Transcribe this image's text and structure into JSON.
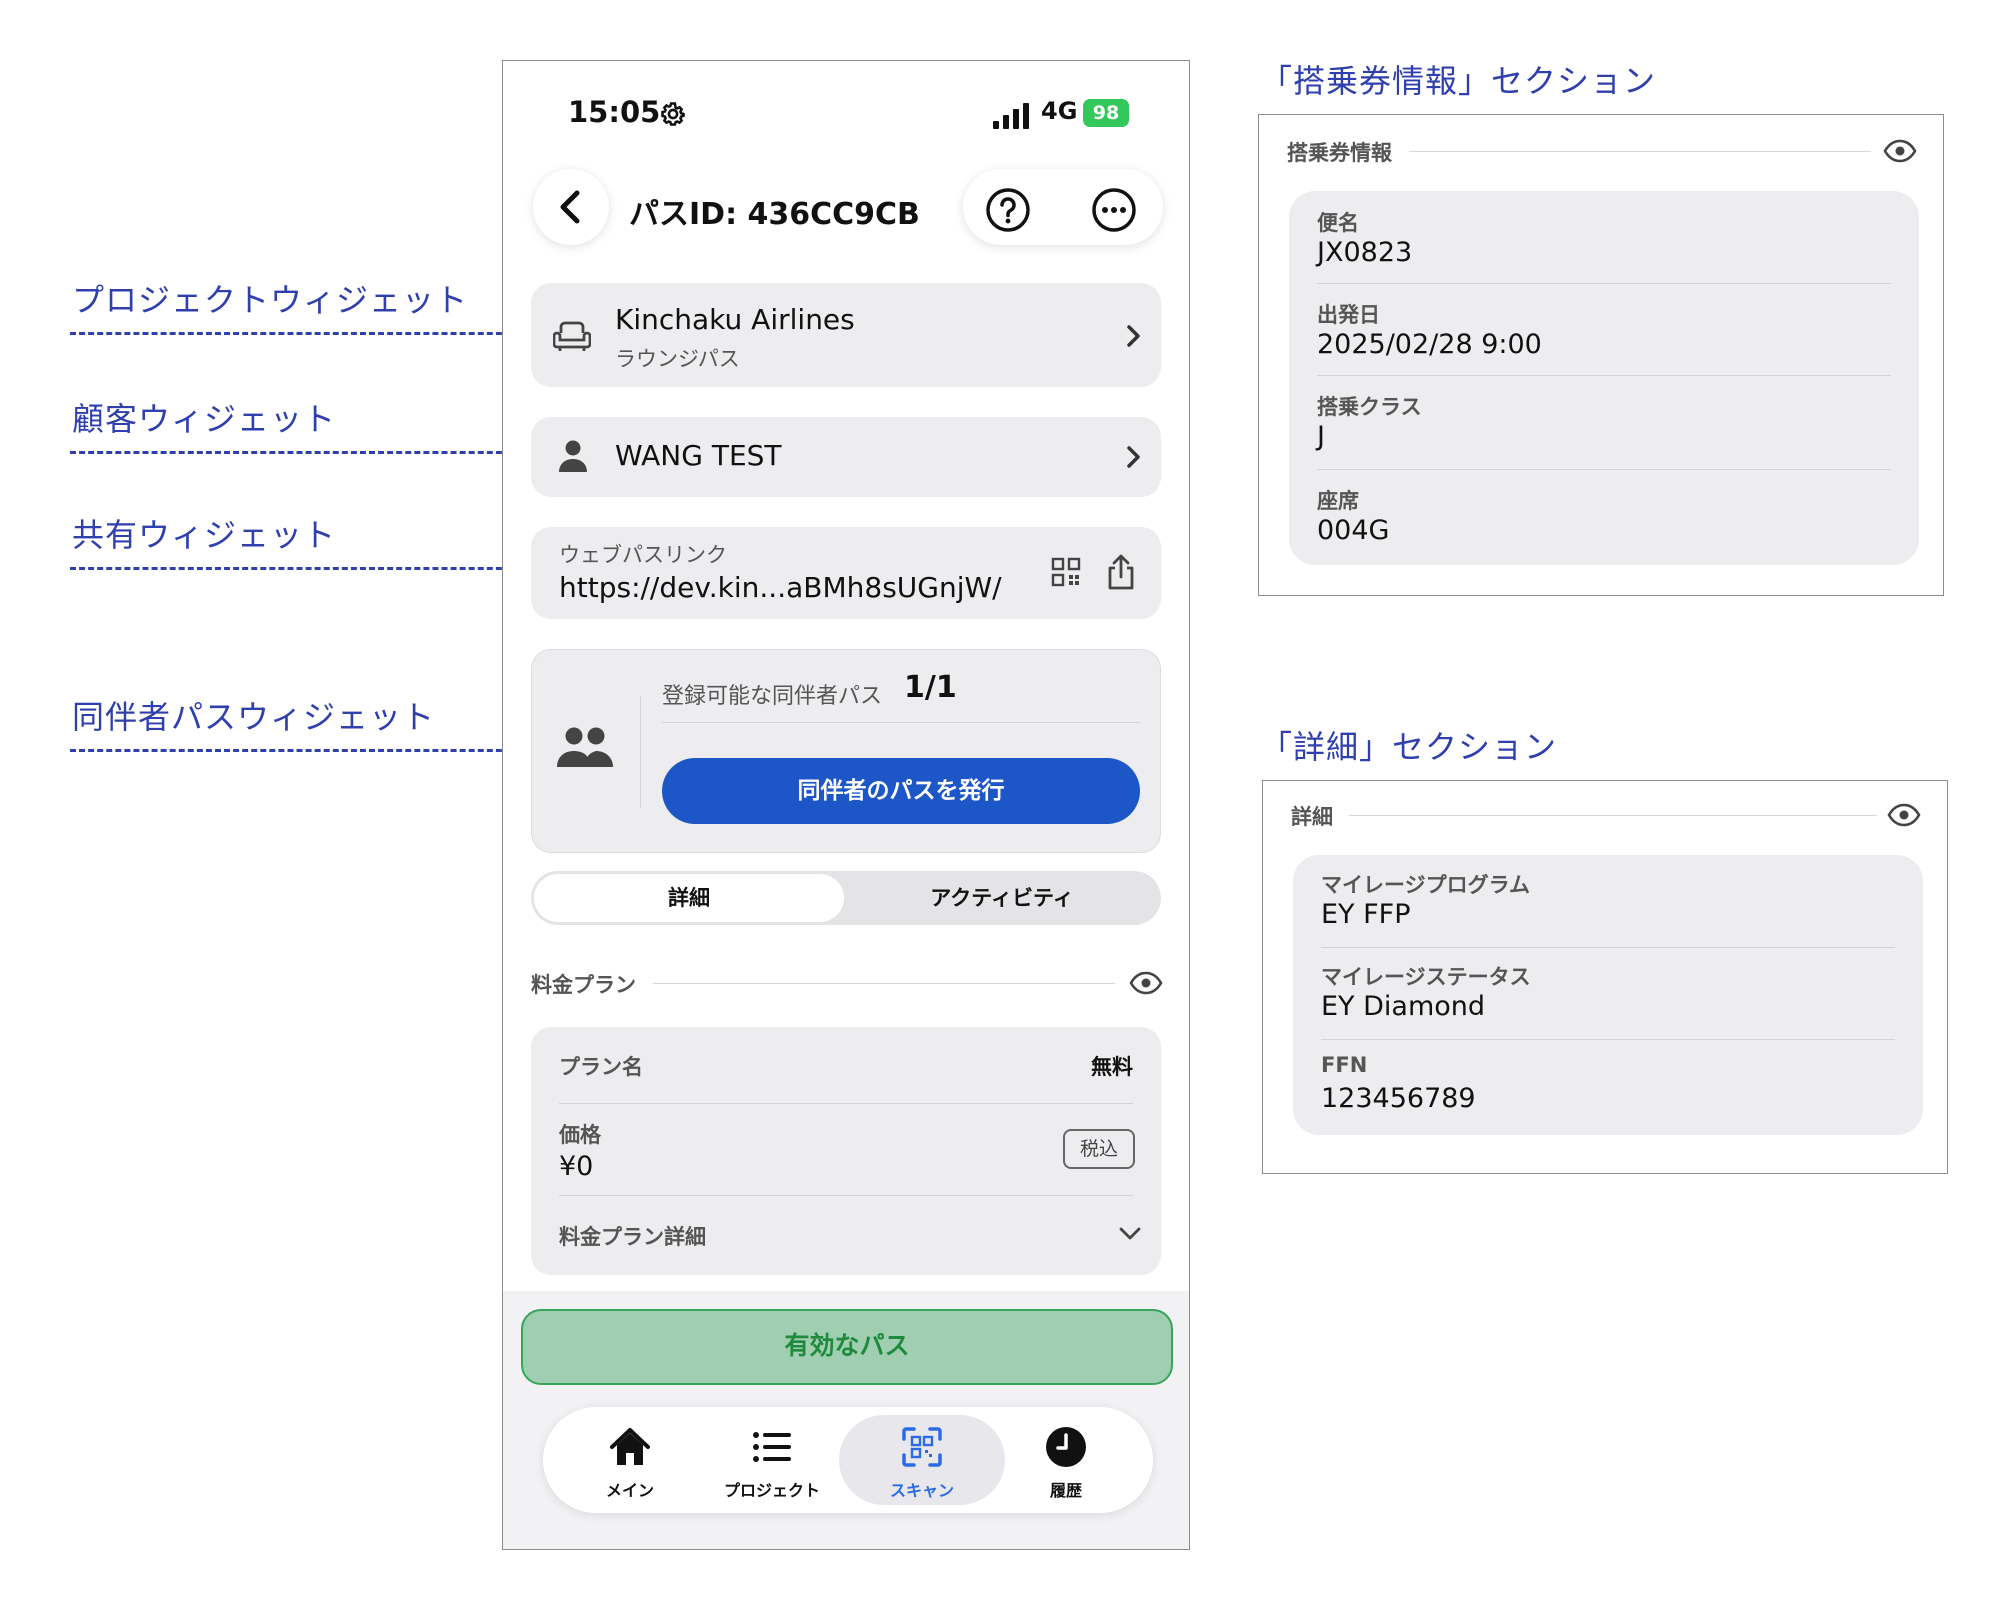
{
  "annotations": {
    "project_widget": "プロジェクトウィジェット",
    "customer_widget": "顧客ウィジェット",
    "share_widget": "共有ウィジェット",
    "companion_widget": "同伴者パスウィジェット"
  },
  "status_bar": {
    "time": "15:05",
    "network": "4G",
    "battery": "98"
  },
  "nav": {
    "title": "パスID: 436CC9CB"
  },
  "project": {
    "name": "Kinchaku Airlines",
    "type": "ラウンジパス"
  },
  "customer": {
    "name": "WANG TEST"
  },
  "share": {
    "label": "ウェブパスリンク",
    "url": "https://dev.kin...aBMh8sUGnjW/"
  },
  "companion": {
    "label": "登録可能な同伴者パス",
    "count": "1/1",
    "button": "同伴者のパスを発行"
  },
  "tabs": {
    "details": "詳細",
    "activity": "アクティビティ"
  },
  "plan": {
    "section_title": "料金プラン",
    "name_label": "プラン名",
    "name_value": "無料",
    "price_label": "価格",
    "price_value": "¥0",
    "tax_tag": "税込",
    "details_label": "料金プラン詳細"
  },
  "valid_button": "有効なパス",
  "tabbar": {
    "main": "メイン",
    "projects": "プロジェクト",
    "scan": "スキャン",
    "history": "履歴"
  },
  "boarding_panel": {
    "heading": "「搭乗券情報」セクション",
    "section_title": "搭乗券情報",
    "rows": [
      {
        "label": "便名",
        "value": "JX0823"
      },
      {
        "label": "出発日",
        "value": "2025/02/28 9:00"
      },
      {
        "label": "搭乗クラス",
        "value": "J"
      },
      {
        "label": "座席",
        "value": "004G"
      }
    ]
  },
  "details_panel": {
    "heading": "「詳細」セクション",
    "section_title": "詳細",
    "rows": [
      {
        "label": "マイレージプログラム",
        "value": "EY FFP"
      },
      {
        "label": "マイレージステータス",
        "value": "EY Diamond"
      },
      {
        "label": "FFN",
        "value": "123456789"
      }
    ]
  },
  "colors": {
    "accent": "#1d56c6",
    "annotation": "#2f3fae",
    "valid": "#9fcfb0",
    "scan_active": "#2d6be4"
  }
}
